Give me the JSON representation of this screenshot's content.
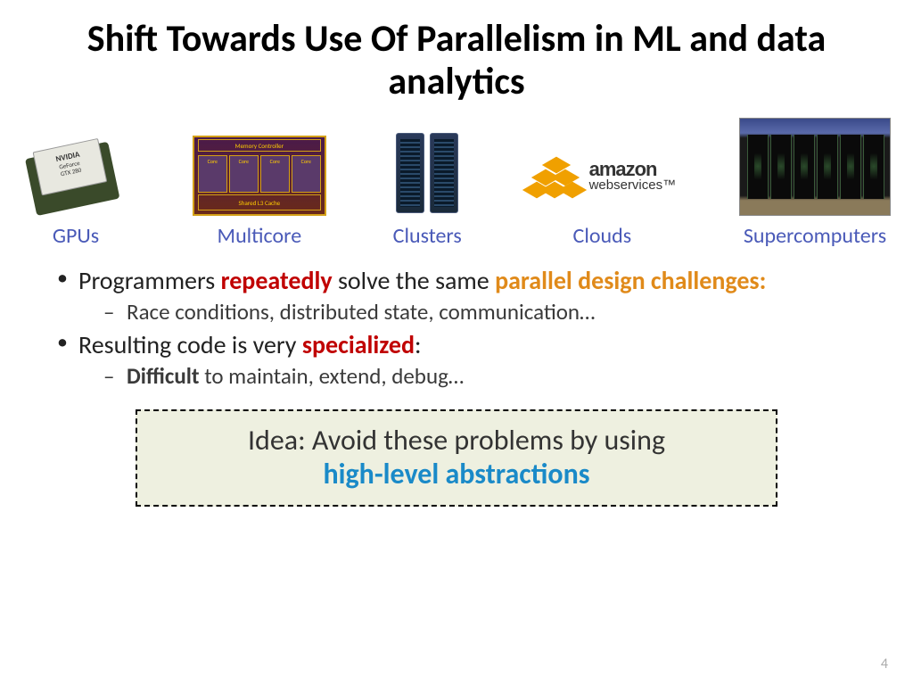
{
  "title": "Shift Towards Use Of Parallelism in ML and data analytics",
  "tech": {
    "gpu": {
      "label": "GPUs",
      "chip_brand": "NVIDIA",
      "chip_line1": "GeForce",
      "chip_line2": "GTX 280"
    },
    "multicore": {
      "label": "Multicore",
      "top": "Memory Controller",
      "core": "Core",
      "cache": "Shared L3 Cache"
    },
    "clusters": {
      "label": "Clusters"
    },
    "clouds": {
      "label": "Clouds",
      "brand": "amazon",
      "sub": "webservices™"
    },
    "supercomputers": {
      "label": "Supercomputers"
    }
  },
  "bullets": {
    "b1_pre": "Programmers ",
    "b1_red": "repeatedly",
    "b1_mid": " solve the same ",
    "b1_orange": "parallel design challenges:",
    "b1_sub": "Race conditions, distributed state, communication…",
    "b2_pre": "Resulting code is very ",
    "b2_red": "specialized",
    "b2_post": ":",
    "b2_sub_bold": "Difficult",
    "b2_sub_rest": " to maintain, extend, debug…"
  },
  "idea": {
    "line1": "Idea: Avoid these problems by using",
    "line2": "high-level abstractions"
  },
  "page_number": "4"
}
